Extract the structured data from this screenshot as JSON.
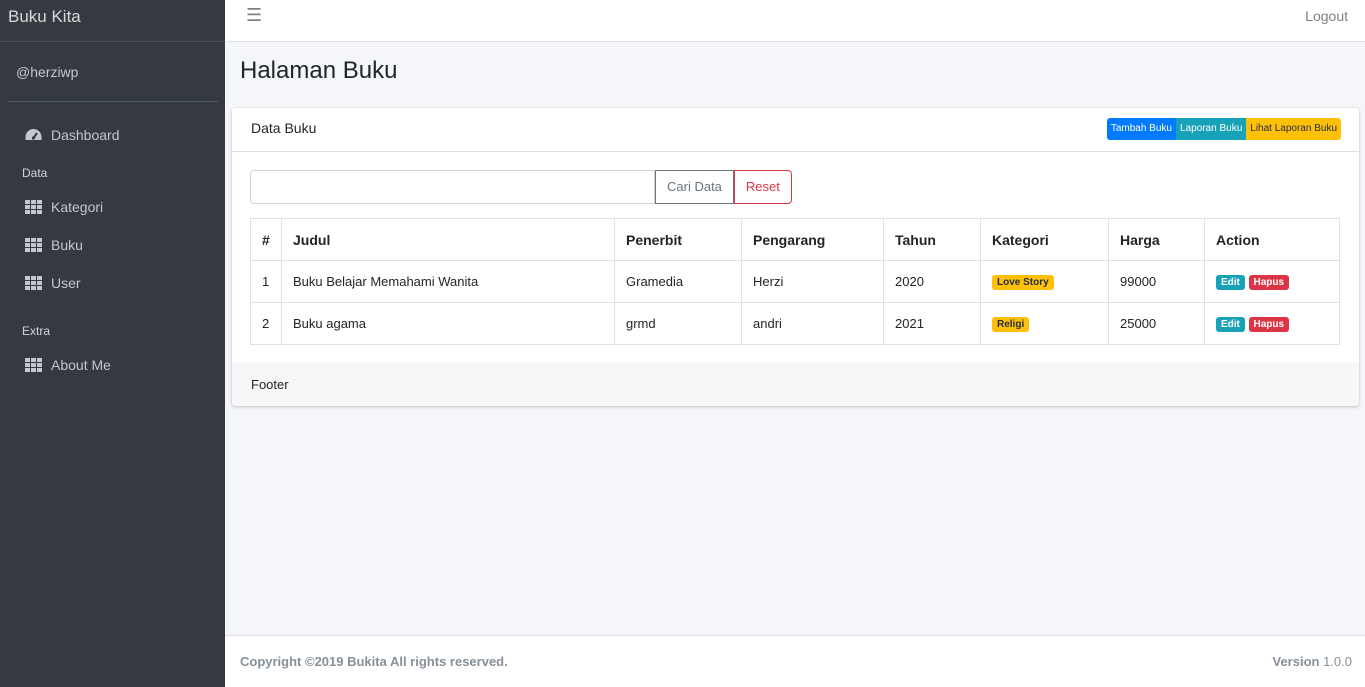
{
  "brand": "Buku Kita",
  "user": "@herziwp",
  "sidebar": {
    "items": [
      {
        "label": "Dashboard",
        "icon": "tachometer-icon"
      },
      {
        "header": "Data"
      },
      {
        "label": "Kategori",
        "icon": "grid-icon"
      },
      {
        "label": "Buku",
        "icon": "grid-icon"
      },
      {
        "label": "User",
        "icon": "grid-icon"
      },
      {
        "header": "Extra"
      },
      {
        "label": "About Me",
        "icon": "grid-icon"
      }
    ]
  },
  "navbar": {
    "menu_icon": "hamburger-icon",
    "logout": "Logout"
  },
  "page": {
    "title": "Halaman Buku"
  },
  "card": {
    "title": "Data Buku",
    "buttons": {
      "tambah": "Tambah Buku",
      "laporan": "Laporan Buku",
      "lihat": "Lihat Laporan Buku"
    },
    "search": {
      "value": "",
      "placeholder": "",
      "cari": "Cari Data",
      "reset": "Reset"
    },
    "footer": "Footer"
  },
  "table": {
    "headers": [
      "#",
      "Judul",
      "Penerbit",
      "Pengarang",
      "Tahun",
      "Kategori",
      "Harga",
      "Action"
    ],
    "rows": [
      {
        "no": "1",
        "judul": "Buku Belajar Memahami Wanita",
        "penerbit": "Gramedia",
        "pengarang": "Herzi",
        "tahun": "2020",
        "kategori": "Love Story",
        "harga": "99000"
      },
      {
        "no": "2",
        "judul": "Buku agama",
        "penerbit": "grmd",
        "pengarang": "andri",
        "tahun": "2021",
        "kategori": "Religi",
        "harga": "25000"
      }
    ],
    "edit_label": "Edit",
    "hapus_label": "Hapus"
  },
  "footer": {
    "copyright": "Copyright ©2019 Bukita All rights reserved.",
    "version_label": "Version",
    "version_value": "1.0.0"
  },
  "colors": {
    "sidebar": "#343a40",
    "primary": "#007bff",
    "info": "#17a2b8",
    "warning": "#ffc107",
    "danger": "#dc3545"
  }
}
